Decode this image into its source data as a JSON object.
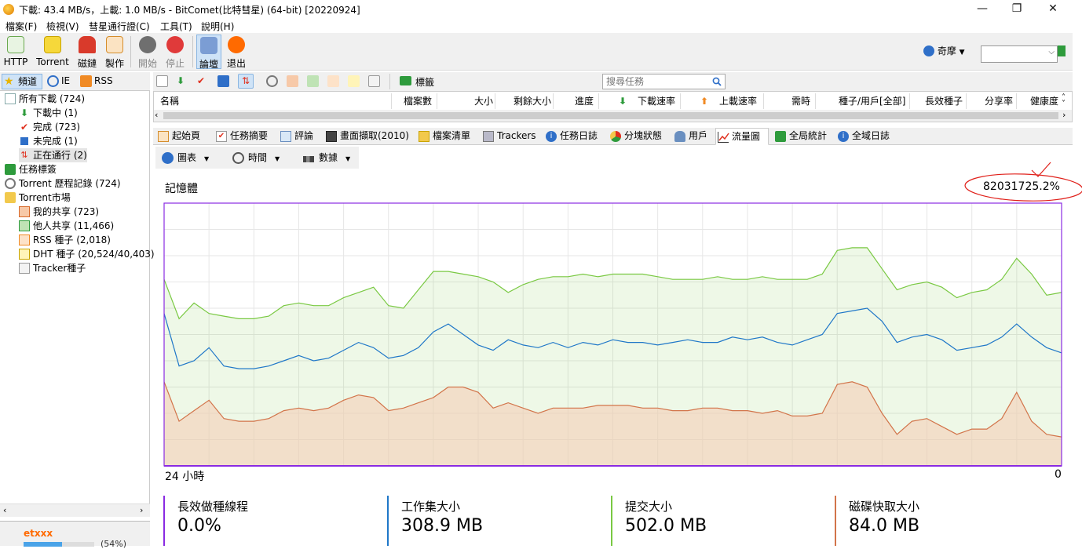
{
  "window": {
    "title": "下載: 43.4 MB/s，上載: 1.0 MB/s - BitComet(比特彗星) (64-bit) [20220924]",
    "minimize": "—",
    "maximize": "❐",
    "close": "✕"
  },
  "menu": [
    "檔案(F)",
    "檢視(V)",
    "彗星通行證(C)",
    "工具(T)",
    "說明(H)"
  ],
  "toolbar": {
    "buttons": [
      "HTTP",
      "Torrent",
      "磁鏈",
      "製作",
      "開始",
      "停止",
      "論壇",
      "退出"
    ],
    "account": "奇摩",
    "account_arrow": "▼"
  },
  "left_tabs": [
    "頻道",
    "IE",
    "RSS"
  ],
  "tree": [
    {
      "label": "所有下載 (724)"
    },
    {
      "label": "下載中 (1)"
    },
    {
      "label": "完成 (723)"
    },
    {
      "label": "未完成 (1)"
    },
    {
      "label": "正在通行 (2)"
    },
    {
      "label": "任務標簽"
    },
    {
      "label": "Torrent 歷程記錄 (724)"
    },
    {
      "label": "Torrent市場"
    },
    {
      "label": "我的共享 (723)"
    },
    {
      "label": "他人共享 (11,466)"
    },
    {
      "label": "RSS 種子 (2,018)"
    },
    {
      "label": "DHT 種子 (20,524/40,403)"
    },
    {
      "label": "Tracker種子"
    }
  ],
  "left_bottom": {
    "user": "etxxx",
    "progress": 0.54,
    "percent_text": "(54%)"
  },
  "right_toolbar": {
    "tag_label": "標籤",
    "search_placeholder": "搜尋任務"
  },
  "table_columns": [
    "名稱",
    "檔案數",
    "大小",
    "剩餘大小",
    "進度",
    "下載速率",
    "上載速率",
    "需時",
    "種子/用戶[全部]",
    "長效種子",
    "分享率",
    "健康度"
  ],
  "tabs": [
    "起始頁",
    "任務摘要",
    "評論",
    "畫面擷取(2010)",
    "檔案清單",
    "Trackers",
    "任務日誌",
    "分塊狀態",
    "用戶",
    "流量圖",
    "全局統計",
    "全域日誌"
  ],
  "active_tab": "流量圖",
  "graph_tools": [
    "圖表",
    "時間",
    "數據"
  ],
  "graph": {
    "title": "記憶體",
    "value": "82031725.2%",
    "x_start": "24 小時",
    "x_end": "0"
  },
  "stats": [
    {
      "label": "長效做種線程",
      "value": "0.0%",
      "color": "#8a2be2"
    },
    {
      "label": "工作集大小",
      "value": "308.9 MB",
      "color": "#1f77c8"
    },
    {
      "label": "提交大小",
      "value": "502.0 MB",
      "color": "#7ac943"
    },
    {
      "label": "磁碟快取大小",
      "value": "84.0 MB",
      "color": "#d2744a"
    }
  ],
  "chart_data": {
    "type": "area",
    "x": [
      0,
      1,
      2,
      3,
      4,
      5,
      6,
      7,
      8,
      9,
      10,
      11,
      12,
      13,
      14,
      15,
      16,
      17,
      18,
      19,
      20,
      21,
      22,
      23,
      24,
      25,
      26,
      27,
      28,
      29,
      30,
      31,
      32,
      33,
      34,
      35,
      36,
      37,
      38,
      39,
      40,
      41,
      42,
      43,
      44,
      45,
      46,
      47,
      48,
      49,
      50,
      51,
      52,
      53,
      54,
      55,
      56,
      57,
      58,
      59,
      60
    ],
    "series": [
      {
        "name": "提交大小",
        "color": "#7ac943",
        "values": [
          71,
          56,
          62,
          58,
          57,
          56,
          56,
          57,
          61,
          62,
          61,
          61,
          64,
          66,
          68,
          61,
          60,
          67,
          74,
          74,
          73,
          72,
          70,
          66,
          69,
          71,
          72,
          72,
          73,
          72,
          73,
          73,
          73,
          72,
          71,
          71,
          71,
          72,
          71,
          71,
          72,
          71,
          71,
          71,
          73,
          82,
          83,
          83,
          75,
          67,
          69,
          70,
          68,
          64,
          66,
          67,
          71,
          79,
          73,
          65,
          66
        ]
      },
      {
        "name": "工作集大小",
        "color": "#1f77c8",
        "values": [
          58,
          38,
          40,
          45,
          38,
          37,
          37,
          38,
          40,
          42,
          40,
          41,
          44,
          47,
          45,
          41,
          42,
          45,
          51,
          54,
          50,
          46,
          44,
          48,
          46,
          45,
          47,
          45,
          47,
          46,
          48,
          47,
          47,
          46,
          47,
          48,
          47,
          47,
          49,
          48,
          49,
          47,
          46,
          48,
          50,
          58,
          59,
          60,
          55,
          47,
          49,
          50,
          48,
          44,
          45,
          46,
          49,
          54,
          49,
          45,
          43
        ]
      },
      {
        "name": "磁碟快取大小",
        "color": "#d2744a",
        "values": [
          32,
          17,
          21,
          25,
          18,
          17,
          17,
          18,
          21,
          22,
          21,
          22,
          25,
          27,
          26,
          21,
          22,
          24,
          26,
          30,
          30,
          28,
          22,
          24,
          22,
          20,
          22,
          22,
          22,
          23,
          23,
          23,
          22,
          22,
          21,
          21,
          22,
          22,
          21,
          21,
          20,
          21,
          19,
          19,
          20,
          31,
          32,
          30,
          20,
          12,
          17,
          18,
          15,
          12,
          14,
          14,
          18,
          28,
          17,
          12,
          11
        ]
      },
      {
        "name": "長效做種線程",
        "color": "#8a2be2",
        "values": [
          0,
          0,
          0,
          0,
          0,
          0,
          0,
          0,
          0,
          0,
          0,
          0,
          0,
          0,
          0,
          0,
          0,
          0,
          0,
          0,
          0,
          0,
          0,
          0,
          0,
          0,
          0,
          0,
          0,
          0,
          0,
          0,
          0,
          0,
          0,
          0,
          0,
          0,
          0,
          0,
          0,
          0,
          0,
          0,
          0,
          0,
          0,
          0,
          0,
          0,
          0,
          0,
          0,
          0,
          0,
          0,
          0,
          0,
          0,
          0,
          0
        ]
      }
    ],
    "ylim": [
      0,
      100
    ],
    "grid": true
  }
}
